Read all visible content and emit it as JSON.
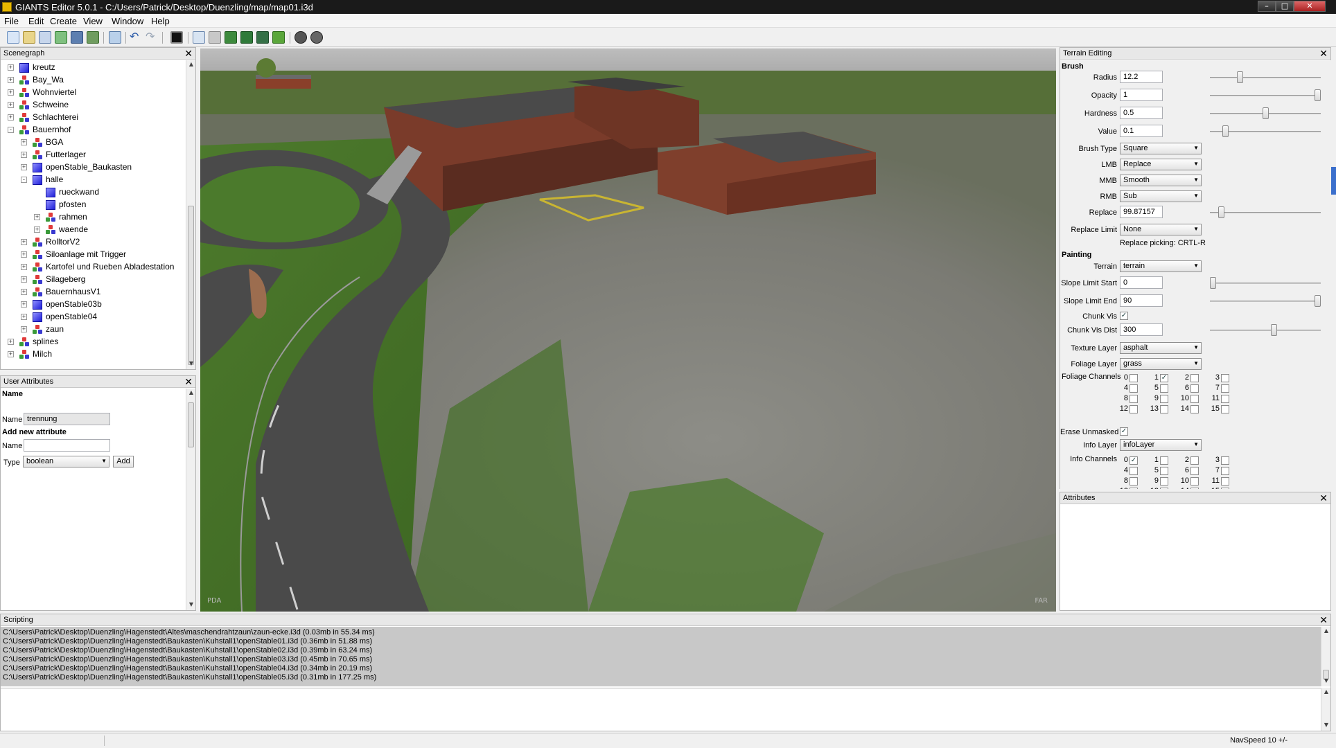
{
  "window": {
    "title": "GIANTS Editor 5.0.1 - C:/Users/Patrick/Desktop/Duenzling/map/map01.i3d"
  },
  "menu": [
    "File",
    "Edit",
    "Create",
    "View",
    "Window",
    "Help"
  ],
  "toolbar_icons": [
    "new-icon",
    "open-icon",
    "import-icon",
    "refresh-icon",
    "save-icon",
    "save-all-icon",
    "reload-icon",
    "undo-icon",
    "redo-icon",
    "stop-icon",
    "select-icon",
    "move-icon",
    "terrain-sculpt-icon",
    "terrain-paint-icon",
    "terrain-foliage-icon",
    "foliage-paint-icon",
    "navigation-icon",
    "camera-icon"
  ],
  "scenegraph": {
    "title": "Scenegraph",
    "nodes": [
      {
        "label": "kreutz",
        "depth": 0,
        "icon": "cube",
        "expander": "+"
      },
      {
        "label": "Bay_Wa",
        "depth": 0,
        "icon": "transform-group",
        "expander": "+"
      },
      {
        "label": "Wohnviertel",
        "depth": 0,
        "icon": "transform-group",
        "expander": "+"
      },
      {
        "label": "Schweine",
        "depth": 0,
        "icon": "transform-group",
        "expander": "+"
      },
      {
        "label": "Schlachterei",
        "depth": 0,
        "icon": "transform-group",
        "expander": "+"
      },
      {
        "label": "Bauernhof",
        "depth": 0,
        "icon": "transform-group",
        "expander": "-"
      },
      {
        "label": "BGA",
        "depth": 1,
        "icon": "transform-group",
        "expander": "+"
      },
      {
        "label": "Futterlager",
        "depth": 1,
        "icon": "transform-group",
        "expander": "+"
      },
      {
        "label": "openStable_Baukasten",
        "depth": 1,
        "icon": "cube",
        "expander": "+"
      },
      {
        "label": "halle",
        "depth": 1,
        "icon": "cube",
        "expander": "-"
      },
      {
        "label": "rueckwand",
        "depth": 2,
        "icon": "cube",
        "expander": ""
      },
      {
        "label": "pfosten",
        "depth": 2,
        "icon": "cube",
        "expander": ""
      },
      {
        "label": "rahmen",
        "depth": 2,
        "icon": "transform-group",
        "expander": "+"
      },
      {
        "label": "waende",
        "depth": 2,
        "icon": "transform-group",
        "expander": "+"
      },
      {
        "label": "RolltorV2",
        "depth": 1,
        "icon": "transform-group",
        "expander": "+"
      },
      {
        "label": "Siloanlage mit Trigger",
        "depth": 1,
        "icon": "transform-group",
        "expander": "+"
      },
      {
        "label": "Kartofel und Rueben Abladestation",
        "depth": 1,
        "icon": "transform-group",
        "expander": "+"
      },
      {
        "label": "Silageberg",
        "depth": 1,
        "icon": "transform-group",
        "expander": "+"
      },
      {
        "label": "BauernhausV1",
        "depth": 1,
        "icon": "transform-group",
        "expander": "+"
      },
      {
        "label": "openStable03b",
        "depth": 1,
        "icon": "cube",
        "expander": "+"
      },
      {
        "label": "openStable04",
        "depth": 1,
        "icon": "cube",
        "expander": "+"
      },
      {
        "label": "zaun",
        "depth": 1,
        "icon": "transform-group",
        "expander": "+"
      },
      {
        "label": "splines",
        "depth": 0,
        "icon": "transform-group",
        "expander": "+"
      },
      {
        "label": "Milch",
        "depth": 0,
        "icon": "transform-group",
        "expander": "+"
      }
    ]
  },
  "user_attributes": {
    "title": "User Attributes",
    "name_header": "Name",
    "name_label": "Name",
    "name_value": "trennung",
    "add_header": "Add new attribute",
    "new_name_label": "Name",
    "new_name_value": "",
    "type_label": "Type",
    "type_value": "boolean",
    "add_button": "Add"
  },
  "terrain_editing": {
    "title": "Terrain Editing",
    "brush_section": "Brush",
    "radius": {
      "label": "Radius",
      "value": "12.2",
      "slider": 0.26
    },
    "opacity": {
      "label": "Opacity",
      "value": "1",
      "slider": 1.0
    },
    "hardness": {
      "label": "Hardness",
      "value": "0.5",
      "slider": 0.5
    },
    "value": {
      "label": "Value",
      "value": "0.1",
      "slider": 0.12
    },
    "brush_type": {
      "label": "Brush Type",
      "value": "Square"
    },
    "lmb": {
      "label": "LMB",
      "value": "Replace"
    },
    "mmb": {
      "label": "MMB",
      "value": "Smooth"
    },
    "rmb": {
      "label": "RMB",
      "value": "Sub"
    },
    "replace": {
      "label": "Replace",
      "value": "99.87157",
      "slider": 0.08
    },
    "replace_limit": {
      "label": "Replace Limit",
      "value": "None"
    },
    "replace_picking": "Replace picking: CRTL-R",
    "painting_section": "Painting",
    "terrain": {
      "label": "Terrain",
      "value": "terrain"
    },
    "slope_start": {
      "label": "Slope Limit Start",
      "value": "0",
      "slider": 0.0
    },
    "slope_end": {
      "label": "Slope Limit End",
      "value": "90",
      "slider": 1.0
    },
    "chunk_vis": {
      "label": "Chunk Vis",
      "checked": true
    },
    "chunk_vis_dist": {
      "label": "Chunk Vis Dist",
      "value": "300",
      "slider": 0.58
    },
    "texture_layer": {
      "label": "Texture Layer",
      "value": "asphalt"
    },
    "foliage_layer": {
      "label": "Foliage Layer",
      "value": "grass"
    },
    "foliage_channels": {
      "label": "Foliage Channels",
      "checked": [
        1
      ]
    },
    "erase_unmasked": {
      "label": "Erase Unmasked",
      "checked": true
    },
    "info_layer": {
      "label": "Info Layer",
      "value": "infoLayer"
    },
    "info_channels": {
      "label": "Info Channels",
      "checked": [
        0
      ]
    },
    "channel_numbers": [
      "0",
      "1",
      "2",
      "3",
      "4",
      "5",
      "6",
      "7",
      "8",
      "9",
      "10",
      "11",
      "12",
      "13",
      "14",
      "15"
    ]
  },
  "attributes": {
    "title": "Attributes"
  },
  "viewport": {
    "watermark_left": "PDA",
    "watermark_right": "FAR"
  },
  "scripting": {
    "title": "Scripting",
    "lines": [
      "C:\\Users\\Patrick\\Desktop\\Duenzling\\Hagenstedt\\Altes\\maschendrahtzaun\\zaun-ecke.i3d (0.03mb in 55.34 ms)",
      "C:\\Users\\Patrick\\Desktop\\Duenzling\\Hagenstedt\\Baukasten\\Kuhstall1\\openStable01.i3d (0.36mb in 51.88 ms)",
      "C:\\Users\\Patrick\\Desktop\\Duenzling\\Hagenstedt\\Baukasten\\Kuhstall1\\openStable02.i3d (0.39mb in 63.24 ms)",
      "C:\\Users\\Patrick\\Desktop\\Duenzling\\Hagenstedt\\Baukasten\\Kuhstall1\\openStable03.i3d (0.45mb in 70.65 ms)",
      "C:\\Users\\Patrick\\Desktop\\Duenzling\\Hagenstedt\\Baukasten\\Kuhstall1\\openStable04.i3d (0.34mb in 20.19 ms)",
      "C:\\Users\\Patrick\\Desktop\\Duenzling\\Hagenstedt\\Baukasten\\Kuhstall1\\openStable05.i3d (0.31mb in 177.25 ms)"
    ]
  },
  "status": {
    "navspeed": "NavSpeed 10 +/-"
  },
  "colors": {
    "accent": "#1f1fd8",
    "panel_header": "#e8e8e8",
    "script_bg": "#c8c8c8"
  }
}
